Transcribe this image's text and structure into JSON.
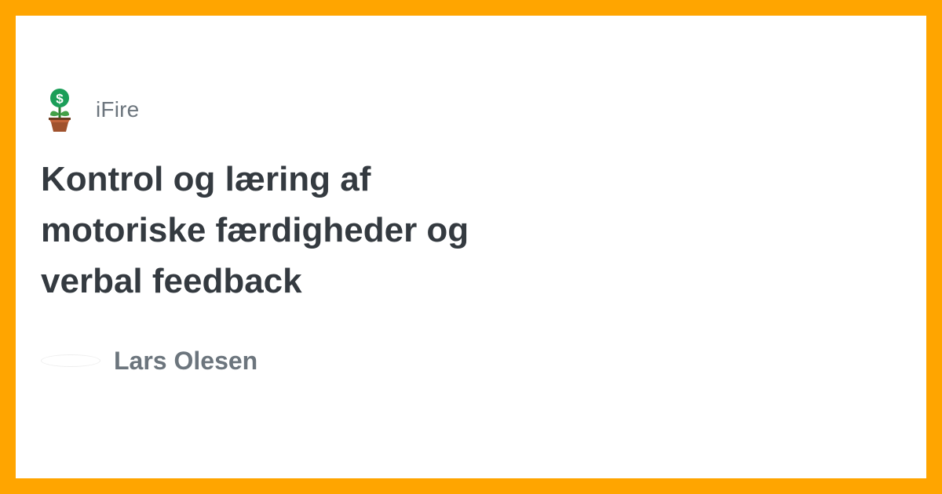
{
  "colors": {
    "frame": "#ffa500",
    "card": "#ffffff",
    "title": "#343a40",
    "muted": "#6c757d",
    "icon_coin": "#1b9e58",
    "icon_pot": "#a0522d"
  },
  "brand": {
    "name": "iFire",
    "icon": "money-plant-icon"
  },
  "article": {
    "title": "Kontrol og læring af motoriske færdigheder og verbal feedback"
  },
  "author": {
    "name": "Lars Olesen",
    "avatar": "avatar-placeholder"
  }
}
